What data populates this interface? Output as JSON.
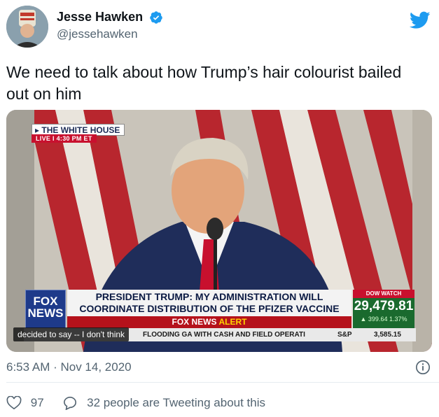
{
  "user": {
    "display_name": "Jesse Hawken",
    "handle": "@jessehawken"
  },
  "tweet": {
    "text": "We need to talk about how Trump’s hair colourist bailed out on him"
  },
  "media": {
    "network_label": "THE WHITE HOUSE",
    "live_label": "LIVE  I  4:30 PM ET",
    "logo": "FOX NEWS channel",
    "headline_line1": "PRESIDENT TRUMP: MY ADMINISTRATION WILL",
    "headline_line2": "COORDINATE DISTRIBUTION OF THE PFIZER VACCINE",
    "alert_prefix": "FOX NEWS",
    "alert_word": "ALERT",
    "ticker_text": "FLOODING GA WITH CASH AND FIELD OPERATI",
    "ticker_index": "S&P",
    "ticker_index_value": "3,585.15",
    "dow_title": "DOW WATCH",
    "dow_value": "29,479.81",
    "dow_change": "▲ 399.64  1.37%",
    "caption": "decided to say -- I don't think"
  },
  "meta": {
    "timestamp": "6:53 AM · Nov 14, 2020"
  },
  "footer": {
    "likes": "97",
    "tweeting": "32 people are Tweeting about this"
  },
  "colors": {
    "twitter_blue": "#1d9bf0",
    "text_secondary": "#536471"
  }
}
